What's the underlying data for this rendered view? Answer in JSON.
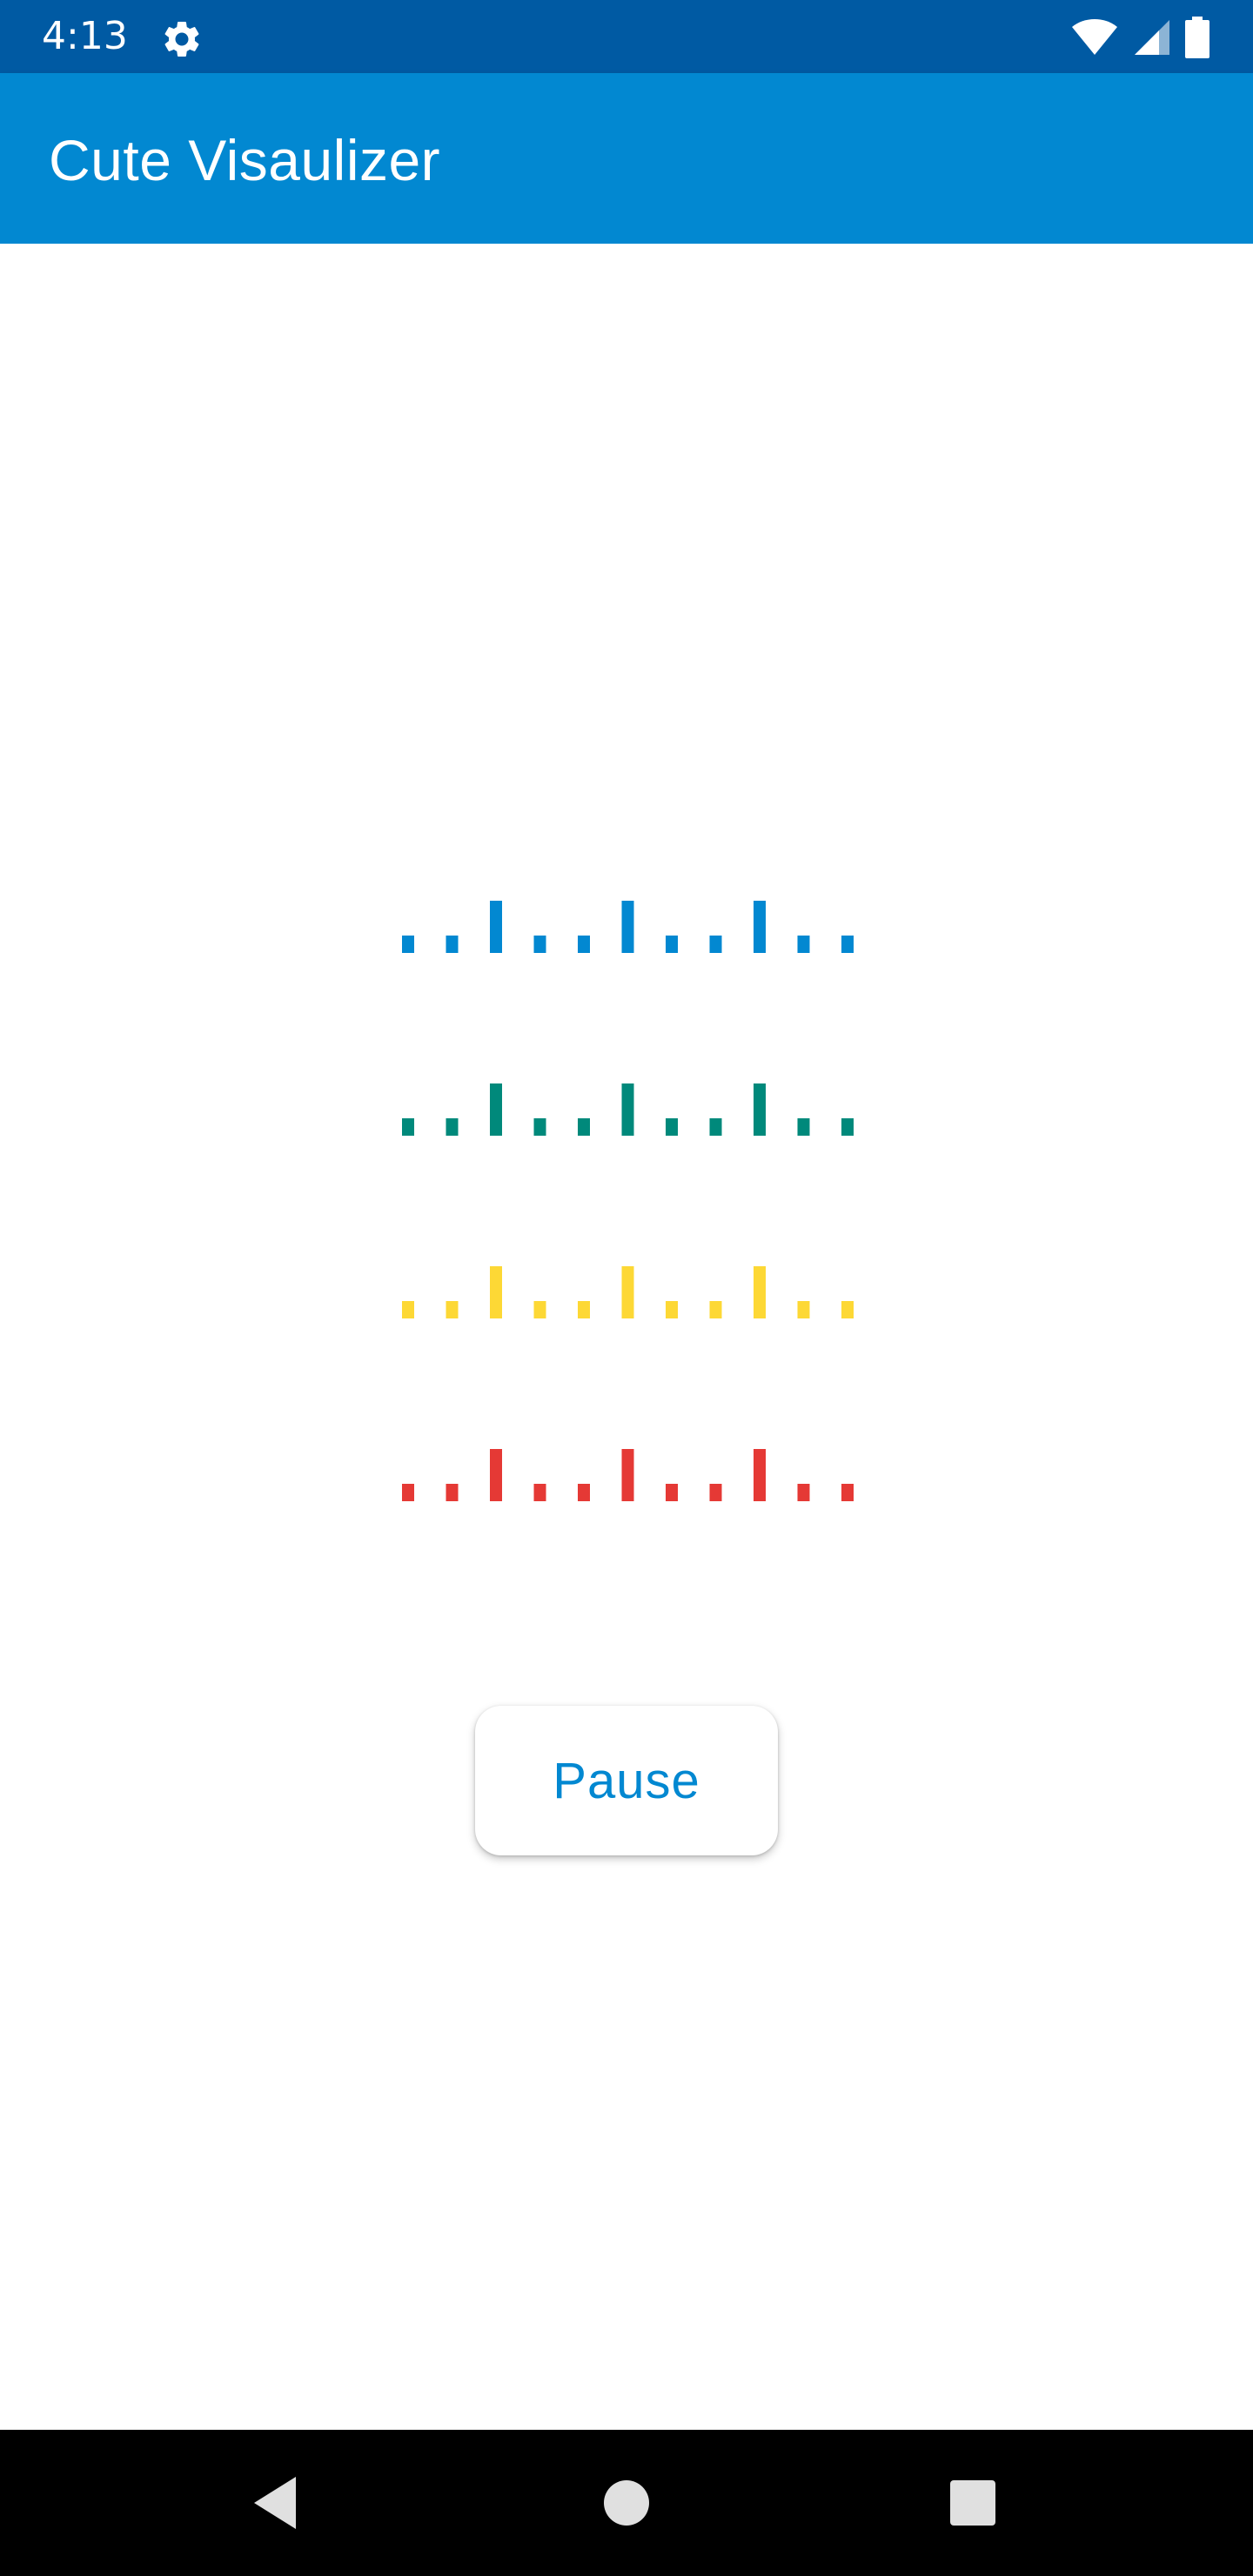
{
  "status_bar": {
    "time": "4:13",
    "icons": [
      "gear-icon",
      "wifi-icon",
      "signal-icon",
      "battery-icon"
    ],
    "background": "#005aa3"
  },
  "app_bar": {
    "title": "Cute Visaulizer",
    "background": "#0288d1"
  },
  "visualizer": {
    "rows": [
      {
        "color": "#0288d1"
      },
      {
        "color": "#00897b"
      },
      {
        "color": "#fdd835"
      },
      {
        "color": "#e53935"
      }
    ],
    "bar_levels": [
      1,
      1,
      3,
      1,
      1,
      3,
      1,
      1,
      3,
      1,
      1
    ]
  },
  "pause_button": {
    "label": "Pause",
    "color": "#0288d1"
  },
  "nav_bar": {
    "buttons": [
      "back-icon",
      "home-icon",
      "recents-icon"
    ]
  }
}
